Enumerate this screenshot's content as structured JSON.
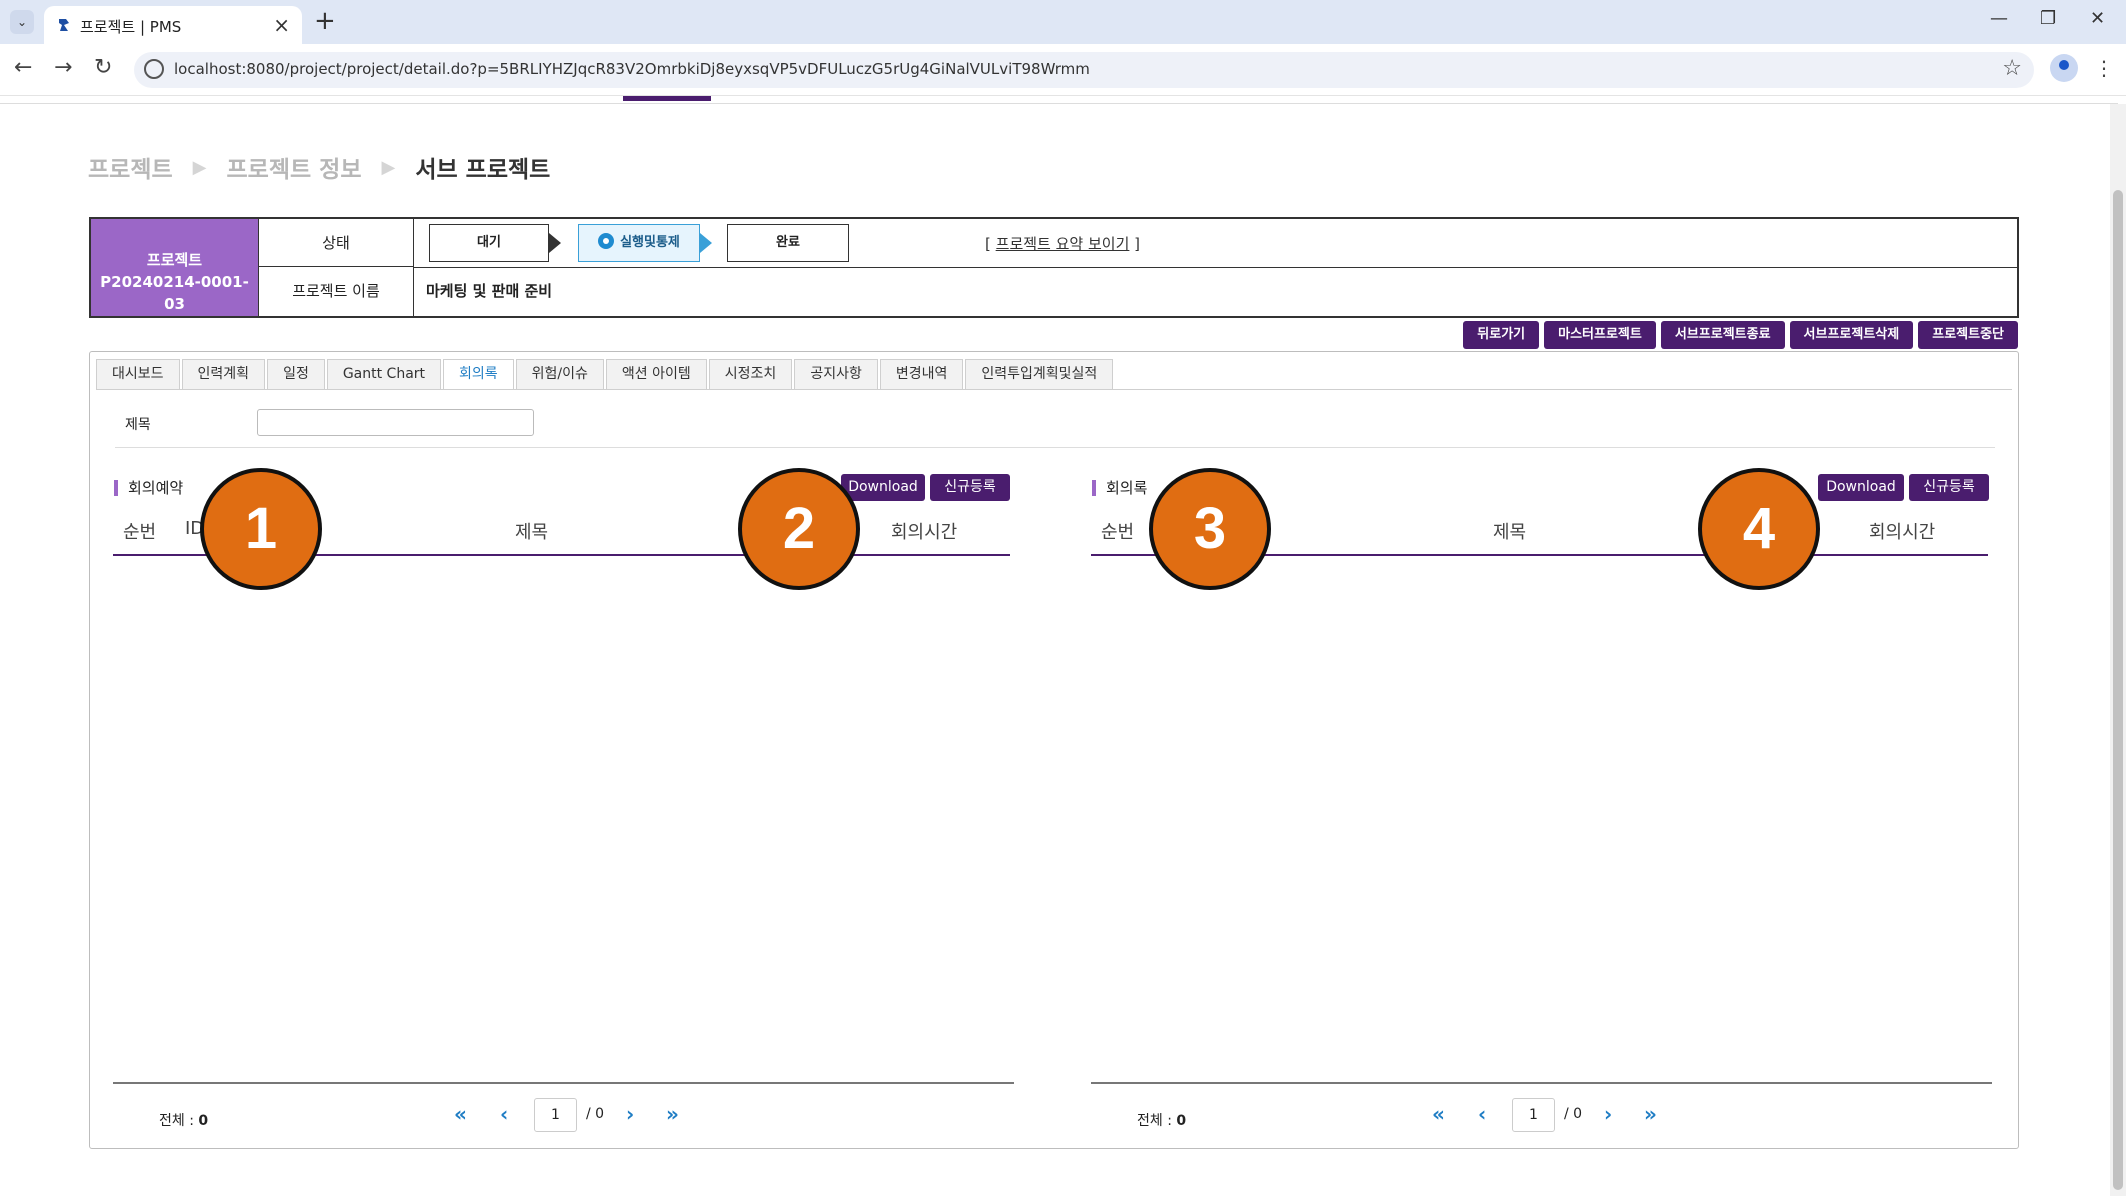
{
  "browser": {
    "tab_title": "프로젝트 | PMS",
    "url": "localhost:8080/project/project/detail.do?p=5BRLIYHZJqcR83V2OmrbkiDj8eyxsqVP5vDFULuczG5rUg4GiNalVULviT98Wrmm",
    "close_glyph": "×",
    "new_tab_glyph": "+",
    "menu_glyph": "⌄",
    "back_glyph": "←",
    "forward_glyph": "→",
    "reload_glyph": "↻",
    "star_glyph": "☆",
    "kebab_glyph": "⋮",
    "minimize_glyph": "—",
    "restore_glyph": "❐",
    "window_close_glyph": "✕"
  },
  "breadcrumb": {
    "items": [
      "프로젝트",
      "프로젝트 정보",
      "서브 프로젝트"
    ],
    "separator": "▶"
  },
  "project": {
    "label": "프로젝트",
    "code": "P20240214-0001-03",
    "status_label": "상태",
    "steps": [
      "대기",
      "실행및통제",
      "완료"
    ],
    "active_step": "실행및통제",
    "summary_link": "프로젝트 요약 보이기",
    "summary_open": "[",
    "summary_close": "]",
    "name_label": "프로젝트 이름",
    "name_value": "마케팅 및 판매 준비"
  },
  "actions": [
    "뒤로가기",
    "마스터프로젝트",
    "서브프로젝트종료",
    "서브프로젝트삭제",
    "프로젝트중단"
  ],
  "tabs": {
    "items": [
      "대시보드",
      "인력계획",
      "일정",
      "Gantt Chart",
      "회의록",
      "위험/이슈",
      "액션 아이템",
      "시정조치",
      "공지사항",
      "변경내역",
      "인력투입계획및실적"
    ],
    "active": "회의록"
  },
  "filter": {
    "label": "제목",
    "value": ""
  },
  "left_section": {
    "title": "회의예약",
    "download": "Download",
    "register": "신규등록",
    "columns": [
      "순번",
      "ID",
      "제목",
      "회의시간"
    ],
    "total_label": "전체 :",
    "total_value": "0",
    "page": "1",
    "pages": "/ 0"
  },
  "right_section": {
    "title": "회의록",
    "download": "Download",
    "register": "신규등록",
    "columns": [
      "순번",
      "제목",
      "회의시간"
    ],
    "total_label": "전체 :",
    "total_value": "0",
    "page": "1",
    "pages": "/ 0"
  },
  "pager_glyphs": {
    "first": "«",
    "prev": "‹",
    "next": "›",
    "last": "»"
  },
  "markers": [
    "1",
    "2",
    "3",
    "4"
  ],
  "colors": {
    "accent": "#4a1d6e",
    "project_box": "#9b67c7",
    "marker": "#e06d12",
    "link": "#1f7dc4"
  }
}
